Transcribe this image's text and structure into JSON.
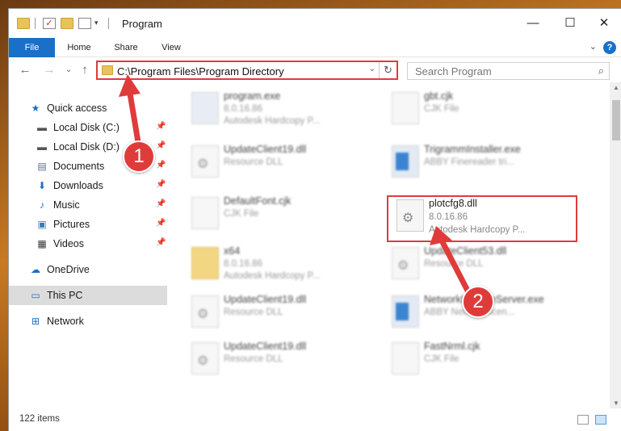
{
  "window": {
    "title": "Program"
  },
  "ribbon": {
    "tabs": [
      "File",
      "Home",
      "Share",
      "View"
    ],
    "help": "?"
  },
  "address": {
    "path": "C:\\Program Files\\Program Directory"
  },
  "search": {
    "placeholder": "Search Program"
  },
  "sidebar": {
    "items": [
      {
        "label": "Quick access",
        "icon": "star-icon"
      },
      {
        "label": "Local Disk (C:)",
        "icon": "drive-icon"
      },
      {
        "label": "Local Disk (D:)",
        "icon": "drive-icon"
      },
      {
        "label": "Documents",
        "icon": "documents-icon"
      },
      {
        "label": "Downloads",
        "icon": "download-icon"
      },
      {
        "label": "Music",
        "icon": "music-icon"
      },
      {
        "label": "Pictures",
        "icon": "pictures-icon"
      },
      {
        "label": "Videos",
        "icon": "videos-icon"
      },
      {
        "label": "OneDrive",
        "icon": "cloud-icon"
      },
      {
        "label": "This PC",
        "icon": "computer-icon"
      },
      {
        "label": "Network",
        "icon": "network-icon"
      }
    ]
  },
  "files": {
    "left": [
      {
        "name": "program.exe",
        "line1": "8.0.16.86",
        "line2": "Autodesk Hardcopy P..."
      },
      {
        "name": "UpdateClient19.dll",
        "line1": "Resource DLL",
        "line2": ""
      },
      {
        "name": "DefaultFont.cjk",
        "line1": "CJK File",
        "line2": ""
      },
      {
        "name": "x64",
        "line1": "8.0.16.86",
        "line2": "Autodesk Hardcopy P..."
      },
      {
        "name": "UpdateClient19.dll",
        "line1": "Resource DLL",
        "line2": ""
      },
      {
        "name": "UpdateClient19.dll",
        "line1": "Resource DLL",
        "line2": ""
      }
    ],
    "right": [
      {
        "name": "gbt.cjk",
        "line1": "CJK File",
        "line2": ""
      },
      {
        "name": "TrigrammInstaller.exe",
        "line1": "ABBY Finereader tri...",
        "line2": ""
      },
      {
        "name": "plotcfg8.dll",
        "line1": "8.0.16.86",
        "line2": "Autodesk Hardcopy P..."
      },
      {
        "name": "UpdateClient53.dll",
        "line1": "Resource DLL",
        "line2": ""
      },
      {
        "name": "NetworkLicenseServer.exe",
        "line1": "ABBY Network licen...",
        "line2": ""
      },
      {
        "name": "FastNrml.cjk",
        "line1": "CJK File",
        "line2": ""
      }
    ]
  },
  "status": {
    "count": "122 items"
  },
  "annotations": {
    "badge1": "1",
    "badge2": "2",
    "color": "#e03b3b"
  }
}
